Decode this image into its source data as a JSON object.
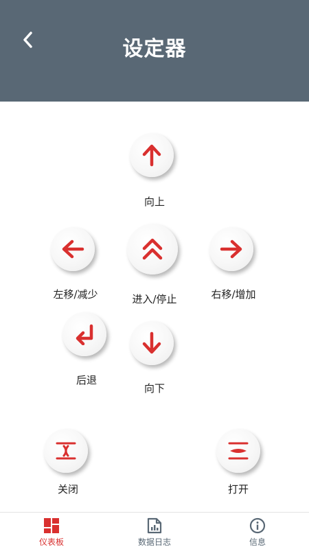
{
  "header": {
    "title": "设定器",
    "back_icon": "chevron-left-icon"
  },
  "colors": {
    "header_bg": "#596875",
    "accent": "#d9302f",
    "tab_inactive": "#596875"
  },
  "controls": {
    "up": {
      "label": "向上",
      "icon": "arrow-up-icon"
    },
    "left": {
      "label": "左移/减少",
      "icon": "arrow-left-icon"
    },
    "enter": {
      "label": "进入/停止",
      "icon": "double-chevron-icon"
    },
    "right": {
      "label": "右移/增加",
      "icon": "arrow-right-icon"
    },
    "back": {
      "label": "后退",
      "icon": "return-arrow-icon"
    },
    "down": {
      "label": "向下",
      "icon": "arrow-down-icon"
    },
    "close": {
      "label": "关闭",
      "icon": "close-valve-icon"
    },
    "open": {
      "label": "打开",
      "icon": "open-valve-icon"
    }
  },
  "tabs": [
    {
      "label": "仪表板",
      "icon": "dashboard-icon",
      "active": true
    },
    {
      "label": "数据日志",
      "icon": "data-log-icon",
      "active": false
    },
    {
      "label": "信息",
      "icon": "info-icon",
      "active": false
    }
  ]
}
